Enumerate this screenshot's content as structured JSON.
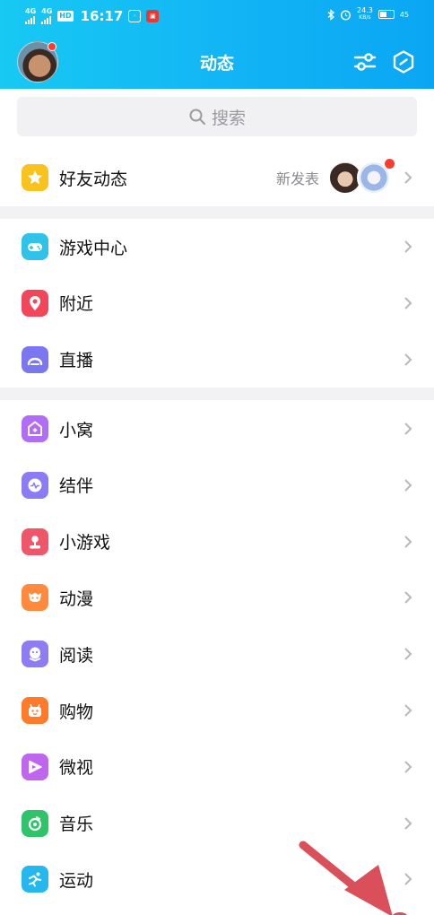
{
  "status_bar": {
    "network_1": "4G",
    "network_2": "4G",
    "hd": "HD",
    "time": "16:17",
    "speed_value": "24.3",
    "speed_unit": "KB/s",
    "battery": "45"
  },
  "header": {
    "title": "动态"
  },
  "search": {
    "placeholder": "搜索"
  },
  "friend_feed": {
    "label": "好友动态",
    "status": "新发表"
  },
  "group_one": [
    {
      "label": "游戏中心",
      "icon": "gamepad-icon",
      "color": "#2fc3ea"
    },
    {
      "label": "附近",
      "icon": "location-pin-icon",
      "color": "#f2475b"
    },
    {
      "label": "直播",
      "icon": "live-icon",
      "color": "#7b77f0"
    }
  ],
  "group_two": [
    {
      "label": "小窝",
      "icon": "home-icon",
      "color": "#b16df5"
    },
    {
      "label": "结伴",
      "icon": "pulse-chat-icon",
      "color": "#8b7cf5"
    },
    {
      "label": "小游戏",
      "icon": "joystick-icon",
      "color": "#f0566a"
    },
    {
      "label": "动漫",
      "icon": "anime-face-icon",
      "color": "#ff8a3d"
    },
    {
      "label": "阅读",
      "icon": "penguin-book-icon",
      "color": "#8e7cf2"
    },
    {
      "label": "购物",
      "icon": "shopping-icon",
      "color": "#ff7a29"
    },
    {
      "label": "微视",
      "icon": "play-icon",
      "color": "#c065ee"
    },
    {
      "label": "音乐",
      "icon": "music-icon",
      "color": "#2fc46a"
    },
    {
      "label": "运动",
      "icon": "running-icon",
      "color": "#25b8ef"
    }
  ],
  "colors": {
    "header_start": "#17c9f3",
    "header_end": "#0aa6f4",
    "badge_red": "#ff3b30",
    "annotation_arrow": "#d9505a"
  }
}
